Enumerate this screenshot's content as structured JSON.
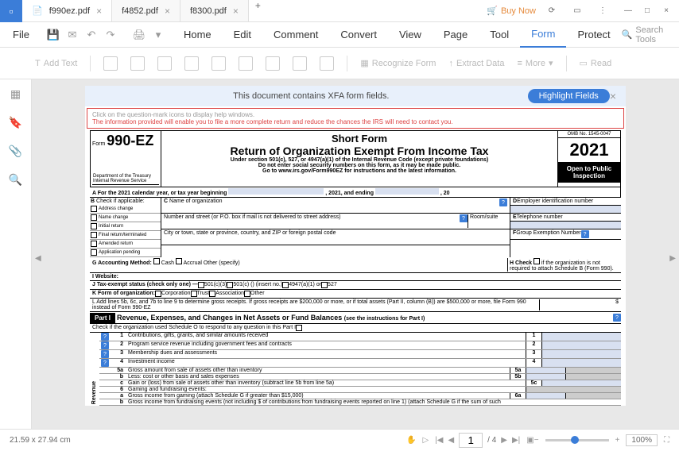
{
  "app": {
    "icon": "▫"
  },
  "tabs": [
    {
      "label": "f990ez.pdf",
      "active": true
    },
    {
      "label": "f4852.pdf",
      "active": false
    },
    {
      "label": "f8300.pdf",
      "active": false
    }
  ],
  "buy_now": "Buy Now",
  "file_menu": "File",
  "menu_tabs": [
    "Home",
    "Edit",
    "Comment",
    "Convert",
    "View",
    "Page",
    "Tool",
    "Form",
    "Protect"
  ],
  "menu_active": "Form",
  "search_tools": "Search Tools",
  "toolbar": {
    "add_text": "Add Text",
    "recognize": "Recognize Form",
    "extract": "Extract Data",
    "more": "More",
    "read": "Read"
  },
  "xfa": {
    "text": "This document contains XFA form fields.",
    "highlight": "Highlight Fields"
  },
  "warning": {
    "line1": "Click on the question-mark icons to display help windows.",
    "line2": "The information provided will enable you to file a more complete return and reduce the chances the IRS will need to contact you."
  },
  "form": {
    "form_word": "Form",
    "form_num": "990-EZ",
    "title1": "Short Form",
    "title2": "Return of Organization Exempt From Income Tax",
    "sub1": "Under section 501(c), 527, or 4947(a)(1) of the Internal Revenue Code (except private foundations)",
    "sub2": "Do not enter social security numbers on this form, as it may be made public.",
    "sub3": "Go to www.irs.gov/Form990EZ for instructions and the latest information.",
    "omb": "OMB No. 1545-0047",
    "year": "2021",
    "open_public": "Open to Public Inspection",
    "dept": "Department of the Treasury  Internal Revenue Service",
    "row_a": "A  For the 2021 calendar year, or tax year beginning",
    "row_a_mid": ", 2021, and ending",
    "row_a_end": ", 20",
    "b_label": "B",
    "b_check": "Check if applicable:",
    "b_items": [
      "Address change",
      "Name change",
      "Initial return",
      "Final return/terminated",
      "Amended return",
      "Application pending"
    ],
    "c_label": "C",
    "c_name": "Name of organization",
    "c_street": "Number and street (or P.O. box if mail is not delivered to street address)",
    "c_room": "Room/suite",
    "c_city": "City or town, state or province, country, and ZIP or foreign postal code",
    "d_label": "D",
    "d_ein": "Employer identification number",
    "e_label": "E",
    "e_tel": "Telephone number",
    "f_label": "F",
    "f_group": "Group Exemption Number",
    "g": "G  Accounting Method:",
    "g_cash": "Cash",
    "g_accrual": "Accrual",
    "g_other": "Other (specify)",
    "h": "H  Check",
    "h_text": "if the organization is not  required to attach Schedule B (Form 990).",
    "i": "I  Website:",
    "j": "J  Tax-exempt status (check only one) —",
    "j_501c3": "501(c)(3)",
    "j_501c": "501(c) (",
    "j_insert": ")  (insert no.)",
    "j_4947": "4947(a)(1) or",
    "j_527": "527",
    "k": "K  Form of organization:",
    "k_corp": "Corporation",
    "k_trust": "Trust",
    "k_assoc": "Association",
    "k_other": "Other",
    "l": "L  Add lines 5b, 6c, and 7b to line 9 to determine gross receipts. If gross receipts are $200,000 or more, or if total assets (Part II, column (B)) are $500,000 or more, file Form 990 instead of Form 990-EZ",
    "l_dollar": "$",
    "part1": "Part I",
    "part1_title": "Revenue, Expenses, and Changes in Net Assets or Fund Balances",
    "part1_see": "(see the instructions for Part I)",
    "part1_check": "Check if the organization used Schedule O to respond to any question in this Part I",
    "lines": [
      {
        "num": "1",
        "text": "Contributions, gifts, grants, and similar amounts received",
        "box": "1"
      },
      {
        "num": "2",
        "text": "Program service revenue including government fees and contracts",
        "box": "2"
      },
      {
        "num": "3",
        "text": "Membership dues and assessments",
        "box": "3"
      },
      {
        "num": "4",
        "text": "Investment income",
        "box": "4"
      },
      {
        "num": "5a",
        "text": "Gross amount from sale of assets other than inventory",
        "box": "5a",
        "mid": true
      },
      {
        "num": "b",
        "text": "Less: cost or other basis and sales expenses",
        "box": "5b",
        "mid": true
      },
      {
        "num": "c",
        "text": "Gain or (loss) from sale of assets other than inventory (subtract line 5b from line 5a)",
        "box": "5c"
      },
      {
        "num": "6",
        "text": "Gaming and fundraising events:",
        "box": ""
      },
      {
        "num": "a",
        "text": "Gross income from gaming (attach Schedule G if greater than $15,000)",
        "box": "6a",
        "mid": true
      },
      {
        "num": "b",
        "text": "Gross income from fundraising events (not including           $                    of contributions from fundraising events reported on line 1) (attach Schedule G if the sum of such",
        "box": ""
      }
    ],
    "revenue": "Revenue"
  },
  "status": {
    "dimensions": "21.59 x 27.94 cm",
    "page": "1",
    "total": "/ 4",
    "zoom": "100%"
  }
}
